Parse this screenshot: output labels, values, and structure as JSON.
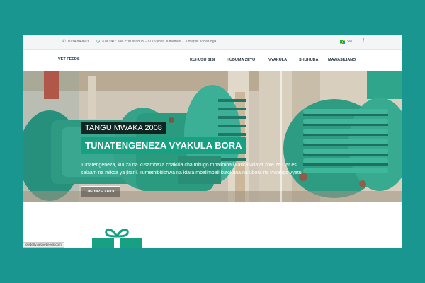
{
  "topbar": {
    "phone": "0734 849603",
    "hours": "Kila siku: saa 2:00 asubuhi - 11:00 jioni. Jumamosi - Jumapili: Tunafunga",
    "language": "Sw"
  },
  "navbar": {
    "logo": "VET FEEDS",
    "items": [
      "KUHUSU SISI",
      "HUDUMA ZETU",
      "VYAKULA",
      "SHUHUDA",
      "MAWASILIANO"
    ]
  },
  "hero": {
    "tagline": "TANGU MWAKA 2008",
    "headline": "TUNATENGENEZA VYAKULA BORA",
    "description": "Tunatengeneza, kuuza na kusambaza chakula cha mifugo mbalimbali katika wilaya zote za Dar es salaam na mikoa ya jirani. Tumethibitishwa na idara mbalimbali kutokana na ubora na viwango vyetu.",
    "cta": "JIFUNZE ZAIDI"
  },
  "statusbar": {
    "url": "owderly.net/vetfeeds.com"
  },
  "colors": {
    "page_background": "#1a9690",
    "accent": "#17a182",
    "machine_green": "#2f9a82",
    "logo_blue": "#1c3d6e"
  },
  "icons": {
    "phone": "phone-icon",
    "clock": "clock-icon",
    "flag": "tanzania-flag-icon",
    "facebook": "facebook-icon",
    "gift": "gift-icon"
  }
}
